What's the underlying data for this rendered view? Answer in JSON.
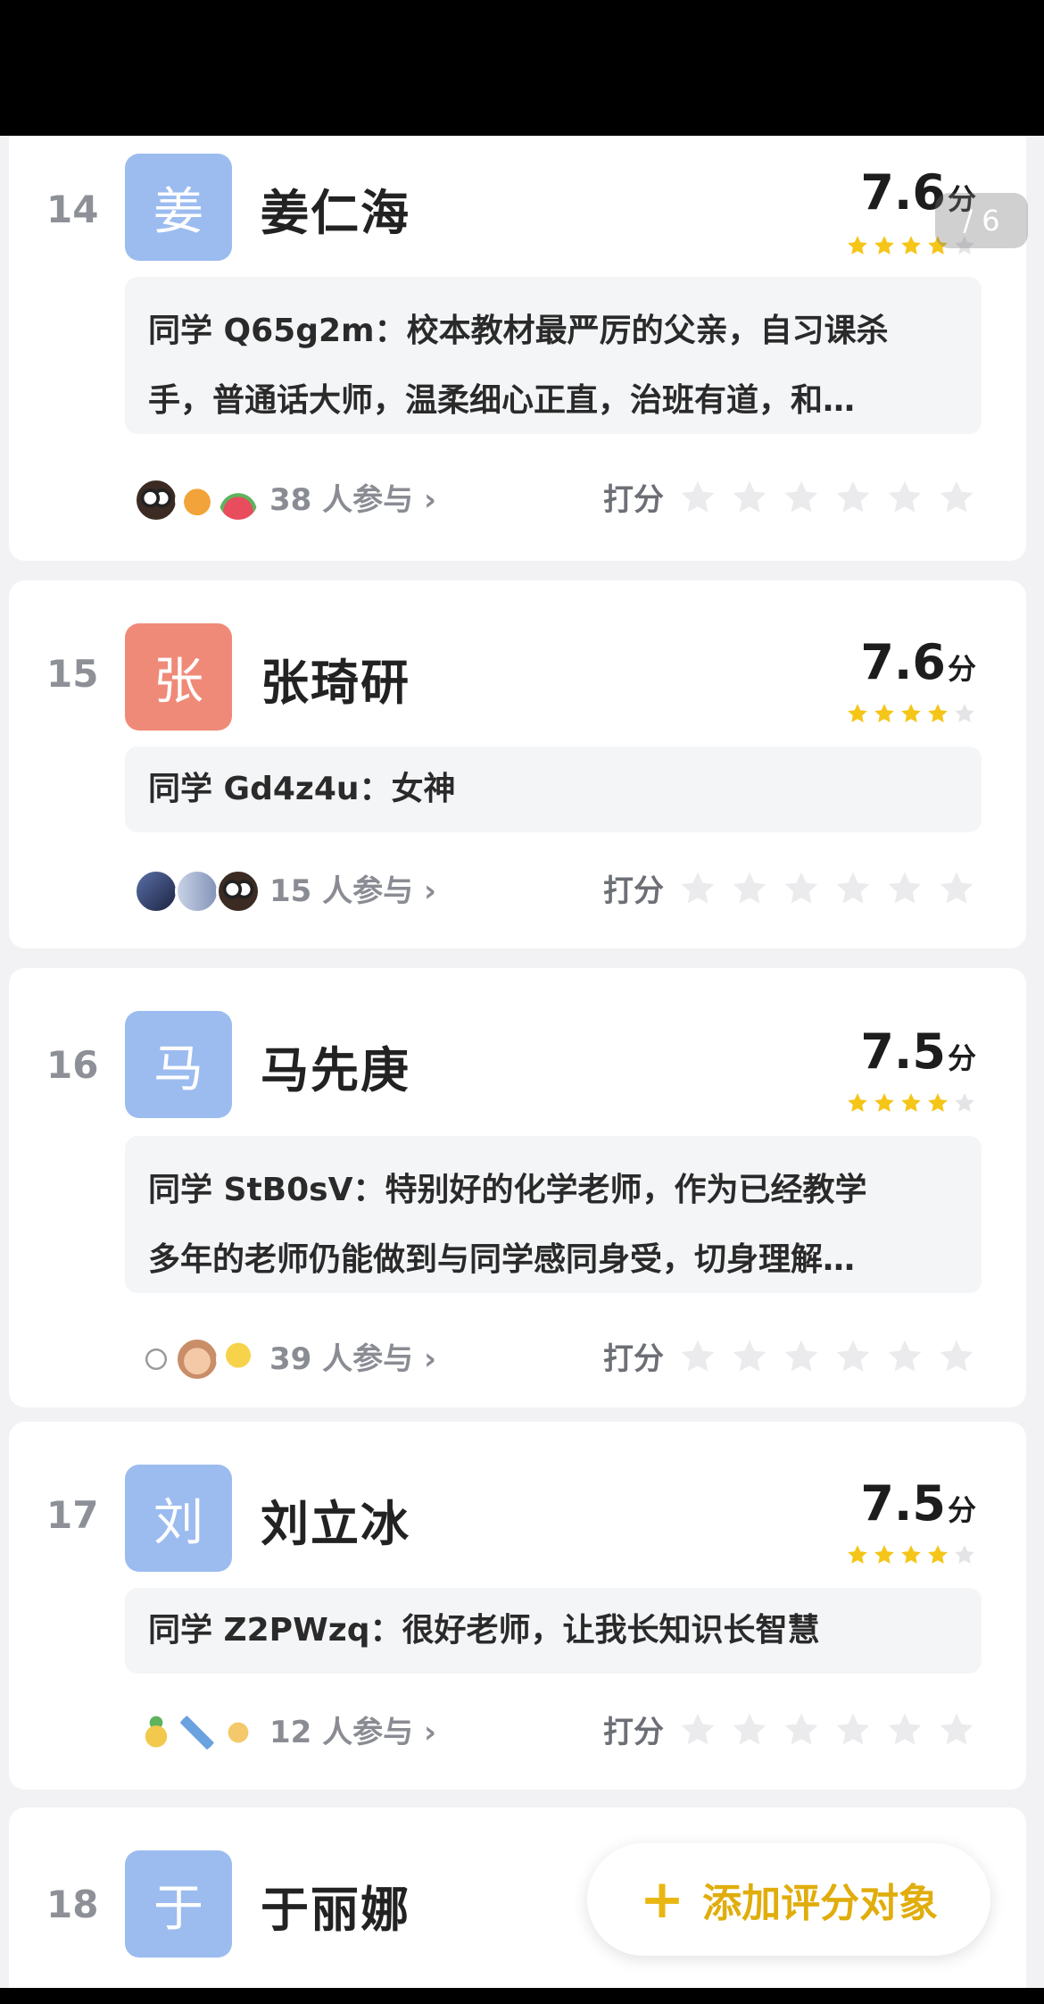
{
  "page_indicator": "/ 6",
  "score_unit": "分",
  "rate_label": "打分",
  "add_button": {
    "label": "添加评分对象"
  },
  "colors": {
    "accent": "#f5c518",
    "blue_avatar": "#9cbcf0",
    "red_avatar": "#f08a78"
  },
  "teachers": [
    {
      "rank": "14",
      "avatar_char": "姜",
      "avatar_color": "#9cbcf0",
      "name": "姜仁海",
      "score": "7.6",
      "stars": 4,
      "comment_line1": "同学 Q65g2m：校本教材最严厉的父亲，自习课杀",
      "comment_line2": "手，普通话大师，温柔细心正直，治班有道，和…",
      "participants": "38 人参与 ›",
      "emoji_icons": [
        "owl-face-icon",
        "mango-icon",
        "watermelon-icon"
      ]
    },
    {
      "rank": "15",
      "avatar_char": "张",
      "avatar_color": "#f08a78",
      "name": "张琦研",
      "score": "7.6",
      "stars": 4,
      "comment_line1": "同学 Gd4z4u：女神",
      "comment_line2": "",
      "participants": "15 人参与 ›",
      "emoji_icons": [
        "dark-photo-avatar-icon",
        "blue-photo-avatar-icon",
        "owl-face-icon"
      ]
    },
    {
      "rank": "16",
      "avatar_char": "马",
      "avatar_color": "#9cbcf0",
      "name": "马先庚",
      "score": "7.5",
      "stars": 4,
      "comment_line1": "同学 StB0sV：特别好的化学老师，作为已经教学",
      "comment_line2": "多年的老师仍能做到与同学感同身受，切身理解…",
      "participants": "39 人参与 ›",
      "emoji_icons": [
        "molecule-icon",
        "bear-face-icon",
        "umbrella-icon"
      ]
    },
    {
      "rank": "17",
      "avatar_char": "刘",
      "avatar_color": "#9cbcf0",
      "name": "刘立冰",
      "score": "7.5",
      "stars": 4,
      "comment_line1": "同学 Z2PWzq：很好老师，让我长知识长智慧",
      "comment_line2": "",
      "participants": "12 人参与 ›",
      "emoji_icons": [
        "pineapple-icon",
        "pickaxe-icon",
        "peanut-icon"
      ]
    },
    {
      "rank": "18",
      "avatar_char": "于",
      "avatar_color": "#9cbcf0",
      "name": "于丽娜"
    }
  ]
}
